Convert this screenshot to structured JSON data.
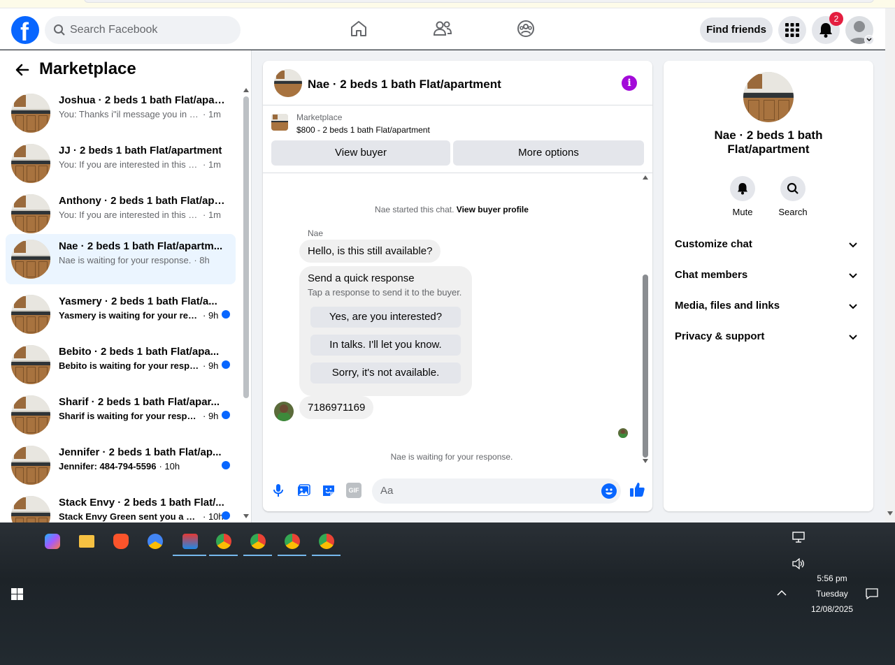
{
  "header": {
    "search_placeholder": "Search Facebook",
    "find_friends": "Find friends",
    "notification_count": "2"
  },
  "sidebar": {
    "title": "Marketplace",
    "conversations": [
      {
        "name": "Joshua · 2 beds 1 bath Flat/apart...",
        "preview": "You: Thanks i\"il message you in a ...",
        "time": "· 1m",
        "unread": false
      },
      {
        "name": "JJ · 2 beds 1 bath Flat/apartment",
        "preview": "You: If you are interested in this pl...",
        "time": "· 1m",
        "unread": false
      },
      {
        "name": "Anthony · 2 beds 1 bath Flat/apa...",
        "preview": "You: If you are interested in this pl...",
        "time": "· 1m",
        "unread": false
      },
      {
        "name": "Nae · 2 beds 1 bath Flat/apartm...",
        "preview": "Nae is waiting for your response.",
        "time": "· 8h",
        "unread": false
      },
      {
        "name": "Yasmery · 2 beds 1 bath Flat/a...",
        "preview": "Yasmery is waiting for your resp...",
        "time": "· 9h",
        "unread": true
      },
      {
        "name": "Bebito · 2 beds 1 bath Flat/apa...",
        "preview": "Bebito is waiting for your respo...",
        "time": "· 9h",
        "unread": true
      },
      {
        "name": "Sharif · 2 beds 1 bath Flat/apar...",
        "preview": "Sharif is waiting for your respon...",
        "time": "· 9h",
        "unread": true
      },
      {
        "name": "Jennifer · 2 beds 1 bath Flat/ap...",
        "preview": "Jennifer: 484-794-5596",
        "time": "· 10h",
        "unread": true
      },
      {
        "name": "Stack Envy · 2 beds 1 bath Flat/...",
        "preview": "Stack Envy Green sent you a m...",
        "time": "· 10h",
        "unread": true
      }
    ]
  },
  "chat": {
    "title": "Nae · 2 beds 1 bath Flat/apartment",
    "listing_source": "Marketplace",
    "listing_desc": "$800 - 2 beds 1 bath Flat/apartment",
    "view_buyer": "View buyer",
    "more_options": "More options",
    "started_text": "Nae started this chat.",
    "view_profile": "View buyer profile",
    "sender": "Nae",
    "message1": "Hello, is this still available?",
    "quick_title": "Send a quick response",
    "quick_sub": "Tap a response to send it to the buyer.",
    "quick_options": [
      "Yes, are you interested?",
      "In talks. I'll let you know.",
      "Sorry, it's not available."
    ],
    "message2": "7186971169",
    "waiting": "Nae is waiting for your response.",
    "composer_placeholder": "Aa",
    "gif_label": "GIF"
  },
  "info_panel": {
    "name": "Nae · 2 beds 1 bath Flat/apartment",
    "mute": "Mute",
    "search": "Search",
    "sections": [
      "Customize chat",
      "Chat members",
      "Media, files and links",
      "Privacy & support"
    ]
  },
  "taskbar": {
    "time": "5:56 pm",
    "day": "Tuesday",
    "date": "12/08/2025"
  },
  "colors": {
    "brand": "#0866ff",
    "notification": "#e41e3f",
    "info_icon": "#a30bd9",
    "active_conversation": "#ebf5ff"
  }
}
